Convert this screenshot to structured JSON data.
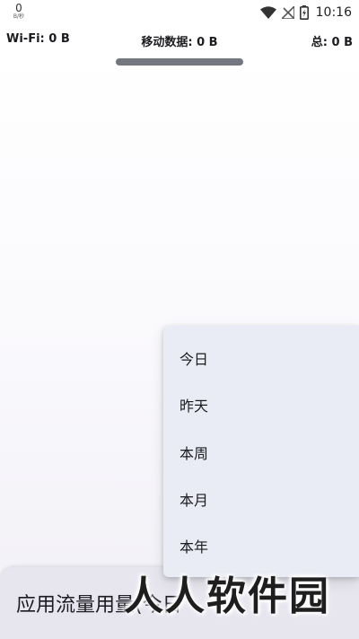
{
  "status_bar": {
    "net_speed": "0",
    "net_speed_unit": "B/秒",
    "time": "10:16",
    "icons": [
      "wifi-icon",
      "no-signal-icon",
      "battery-charging-icon"
    ]
  },
  "summary": {
    "wifi": "Wi-Fi: 0 B",
    "mobile": "移动数据: 0 B",
    "total": "总: 0 B"
  },
  "bottom_card": {
    "title": "应用流量用量(今日"
  },
  "menu": {
    "items": [
      "今日",
      "昨天",
      "本周",
      "本月",
      "本年"
    ]
  },
  "watermark": "人人软件园",
  "colors": {
    "menu_bg": "#e9ecf5",
    "card_bg": "#e7e6ef",
    "handle": "#74777f",
    "text": "#1c1b1f"
  }
}
